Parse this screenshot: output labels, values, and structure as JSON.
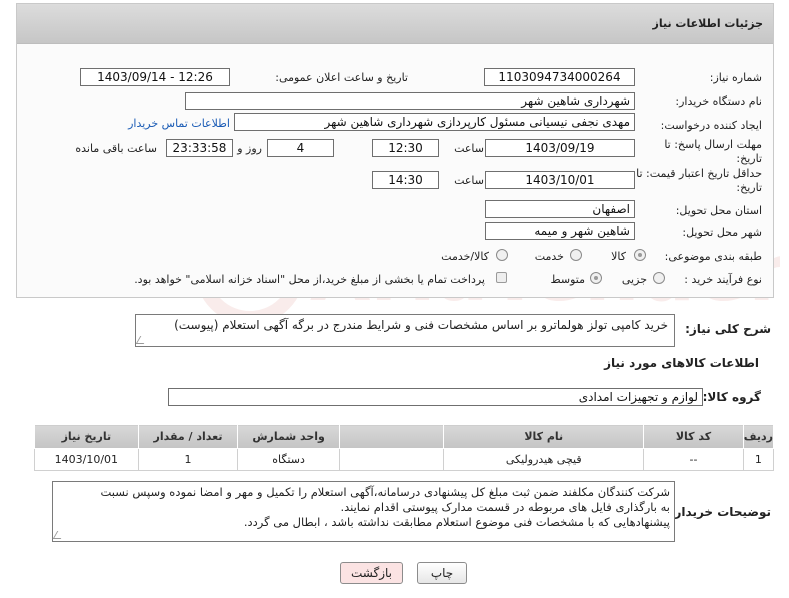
{
  "header": {
    "title": "جزئیات اطلاعات نیاز"
  },
  "form": {
    "need_number_label": "شماره نیاز:",
    "need_number": "1103094734000264",
    "announce_label": "تاریخ و ساعت اعلان عمومی:",
    "announce_value": "1403/09/14 - 12:26",
    "buyer_org_label": "نام دستگاه خریدار:",
    "buyer_org": "شهرداری شاهین شهر",
    "requester_label": "ایجاد کننده درخواست:",
    "requester": "مهدی نجفی نیسیانی مسئول کارپردازی شهرداری شاهین شهر",
    "contact_link": "اطلاعات تماس خریدار",
    "deadline_label_1": "مهلت ارسال پاسخ: تا",
    "deadline_label_2": "تاریخ:",
    "deadline_date": "1403/09/19",
    "time_label": "ساعت",
    "deadline_time": "12:30",
    "days_value": "4",
    "days_label": "روز و",
    "remaining_value": "23:33:58",
    "remaining_label": "ساعت باقی مانده",
    "validity_label_1": "حداقل تاریخ اعتبار قیمت: تا",
    "validity_label_2": "تاریخ:",
    "validity_date": "1403/10/01",
    "validity_time_label": "ساعت",
    "validity_time": "14:30",
    "province_label": "استان محل تحویل:",
    "province": "اصفهان",
    "city_label": "شهر محل تحویل:",
    "city": "شاهین شهر و میمه",
    "category_label": "طبقه بندی موضوعی:",
    "category_options": [
      "کالا",
      "خدمت",
      "کالا/خدمت"
    ],
    "process_label": "نوع فرآیند خرید :",
    "process_options": [
      "جزیی",
      "متوسط"
    ],
    "payment_note": "پرداخت تمام یا بخشی از مبلغ خرید،از محل \"اسناد خزانه اسلامی\" خواهد بود."
  },
  "description": {
    "label": "شرح کلی نیاز:",
    "text": "خرید کامپی تولز هولماترو بر اساس مشخصات فنی و شرایط مندرج در برگه آگهی استعلام (پیوست)"
  },
  "goods": {
    "section_title": "اطلاعات کالاهای مورد نیاز",
    "group_label": "گروه کالا:",
    "group_value": "لوازم و تجهیزات امدادی",
    "columns": [
      "ردیف",
      "کد کالا",
      "نام کالا",
      "واحد شمارش",
      "تعداد / مقدار",
      "تاریخ نیاز"
    ],
    "rows": [
      [
        "1",
        "--",
        "قیچی هیدرولیکی",
        "دستگاه",
        "1",
        "1403/10/01"
      ]
    ]
  },
  "buyer_notes": {
    "label": "توضیحات خریدار:",
    "lines": [
      "شرکت کنندگان مکلفند ضمن ثبت مبلغ کل پیشنهادی درسامانه،آگهی استعلام را  تکمیل و مهر و امضا نموده وسپس نسبت",
      "به بارگذاری فایل های مربوطه در قسمت مدارک پیوستی اقدام نمایند.",
      "پیشنهادهایی که با مشخصات فنی موضوع استعلام مطابقت نداشته باشد ، ابطال می گردد."
    ]
  },
  "buttons": {
    "print": "چاپ",
    "back": "بازگشت"
  },
  "watermark": {
    "text": "AriaTender.neT"
  },
  "colors": {
    "link": "#1a5bb5",
    "back_button_bg": "#fbe3e3",
    "watermark": "#c0392b"
  }
}
